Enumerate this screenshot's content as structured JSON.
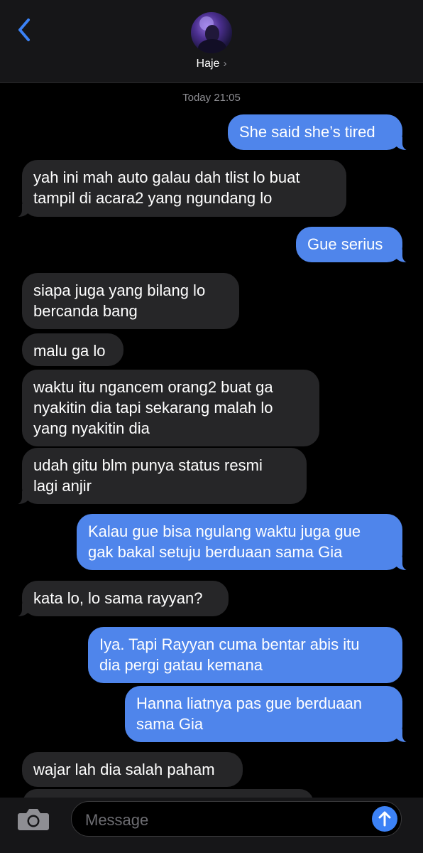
{
  "header": {
    "contact_name": "Haje",
    "chevron": "›"
  },
  "thread": {
    "timestamp": "Today 21:05",
    "messages": [
      {
        "from": "me",
        "text": "She said she’s tired"
      },
      {
        "from": "them",
        "lines": [
          "yah ini mah auto galau dah tlist lo buat",
          "tampil di acara2 yang ngundang lo"
        ]
      },
      {
        "from": "me",
        "text": "Gue serius"
      },
      {
        "from": "them",
        "lines": [
          "siapa juga yang bilang lo",
          "bercanda bang"
        ]
      },
      {
        "from": "them",
        "text": "malu ga lo"
      },
      {
        "from": "them",
        "lines": [
          "waktu itu ngancem orang2 buat ga",
          "nyakitin dia tapi sekarang malah lo",
          "yang nyakitin dia"
        ]
      },
      {
        "from": "them",
        "lines": [
          "udah gitu blm punya status resmi",
          "lagi anjir"
        ]
      },
      {
        "from": "me",
        "lines": [
          "Kalau gue bisa ngulang waktu juga gue",
          "gak bakal setuju berduaan sama Gia"
        ]
      },
      {
        "from": "them",
        "text": "kata lo, lo sama rayyan?"
      },
      {
        "from": "me",
        "lines": [
          "Iya. Tapi Rayyan cuma bentar abis itu",
          "dia pergi gatau kemana"
        ]
      },
      {
        "from": "me",
        "lines": [
          "Hanna liatnya pas gue berduaan",
          "sama Gia"
        ]
      },
      {
        "from": "them",
        "text": "wajar lah dia salah paham"
      }
    ]
  },
  "composer": {
    "placeholder": "Message"
  },
  "icons": {
    "back": "chevron-left-icon",
    "camera": "camera-icon",
    "send": "arrow-up-icon"
  },
  "colors": {
    "accent": "#4f85eb",
    "received": "#262628",
    "background": "#000000"
  }
}
